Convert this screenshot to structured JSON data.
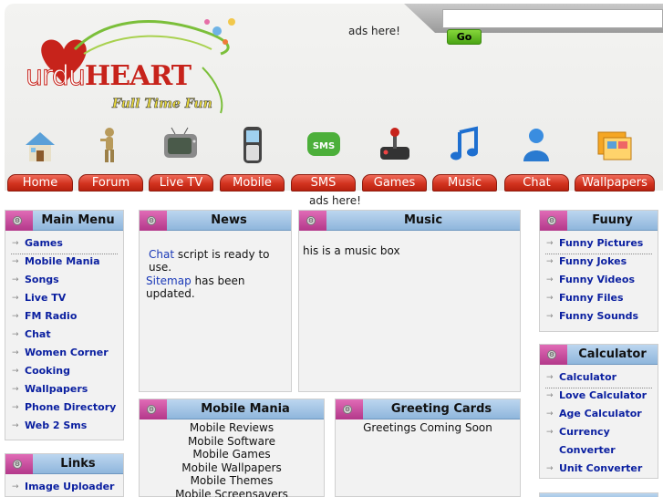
{
  "header": {
    "search_placeholder": "",
    "go_label": "Go",
    "ads_top": "ads here!",
    "logo": {
      "urdu": "urdu",
      "heart": "HEART",
      "tagline": "Full Time Fun"
    }
  },
  "nav": [
    {
      "label": "Home",
      "icon": "house-icon"
    },
    {
      "label": "Forum",
      "icon": "person-icon"
    },
    {
      "label": "Live TV",
      "icon": "tv-icon"
    },
    {
      "label": "Mobile",
      "icon": "phone-icon"
    },
    {
      "label": "SMS",
      "icon": "sms-icon"
    },
    {
      "label": "Games",
      "icon": "joystick-icon"
    },
    {
      "label": "Music",
      "icon": "music-note-icon"
    },
    {
      "label": "Chat",
      "icon": "chat-user-icon"
    },
    {
      "label": "Wallpapers",
      "icon": "wallpaper-icon"
    }
  ],
  "ads_mid": "ads here!",
  "main_menu": {
    "title": "Main Menu",
    "items": [
      "Games",
      "Mobile Mania",
      "Songs",
      "Live TV",
      "FM Radio",
      "Chat",
      "Women Corner",
      "Cooking",
      "Wallpapers",
      "Phone Directory",
      "Web 2 Sms"
    ]
  },
  "links": {
    "title": "Links",
    "items": [
      "Image Uploader"
    ]
  },
  "news": {
    "title": "News",
    "line1_link": "Chat",
    "line1_rest": " script is ready to use.",
    "line2_link": "Sitemap",
    "line2_rest": " has been updated."
  },
  "music": {
    "title": "Music",
    "text": "his is a music box"
  },
  "mobile_mania": {
    "title": "Mobile Mania",
    "items": [
      "Mobile Reviews",
      "Mobile Software",
      "Mobile Games",
      "Mobile Wallpapers",
      "Mobile Themes",
      "Mobile Screensavers"
    ]
  },
  "greeting_cards": {
    "title": "Greeting Cards",
    "text": "Greetings Coming Soon"
  },
  "funny": {
    "title": "Fuuny",
    "items": [
      "Funny Pictures",
      "Funny Jokes",
      "Funny Videos",
      "Funny Files",
      "Funny Sounds"
    ]
  },
  "calculator": {
    "title": "Calculator",
    "items": [
      "Calculator",
      "Love Calculator",
      "Age Calculator",
      "Currency",
      "Converter",
      "Unit Converter"
    ]
  },
  "colors": {
    "nav_red": "#d2331f",
    "box_head_blue": "#8fb6dc",
    "tab_pink": "#b3388a",
    "link_blue": "#0a1fa0"
  }
}
